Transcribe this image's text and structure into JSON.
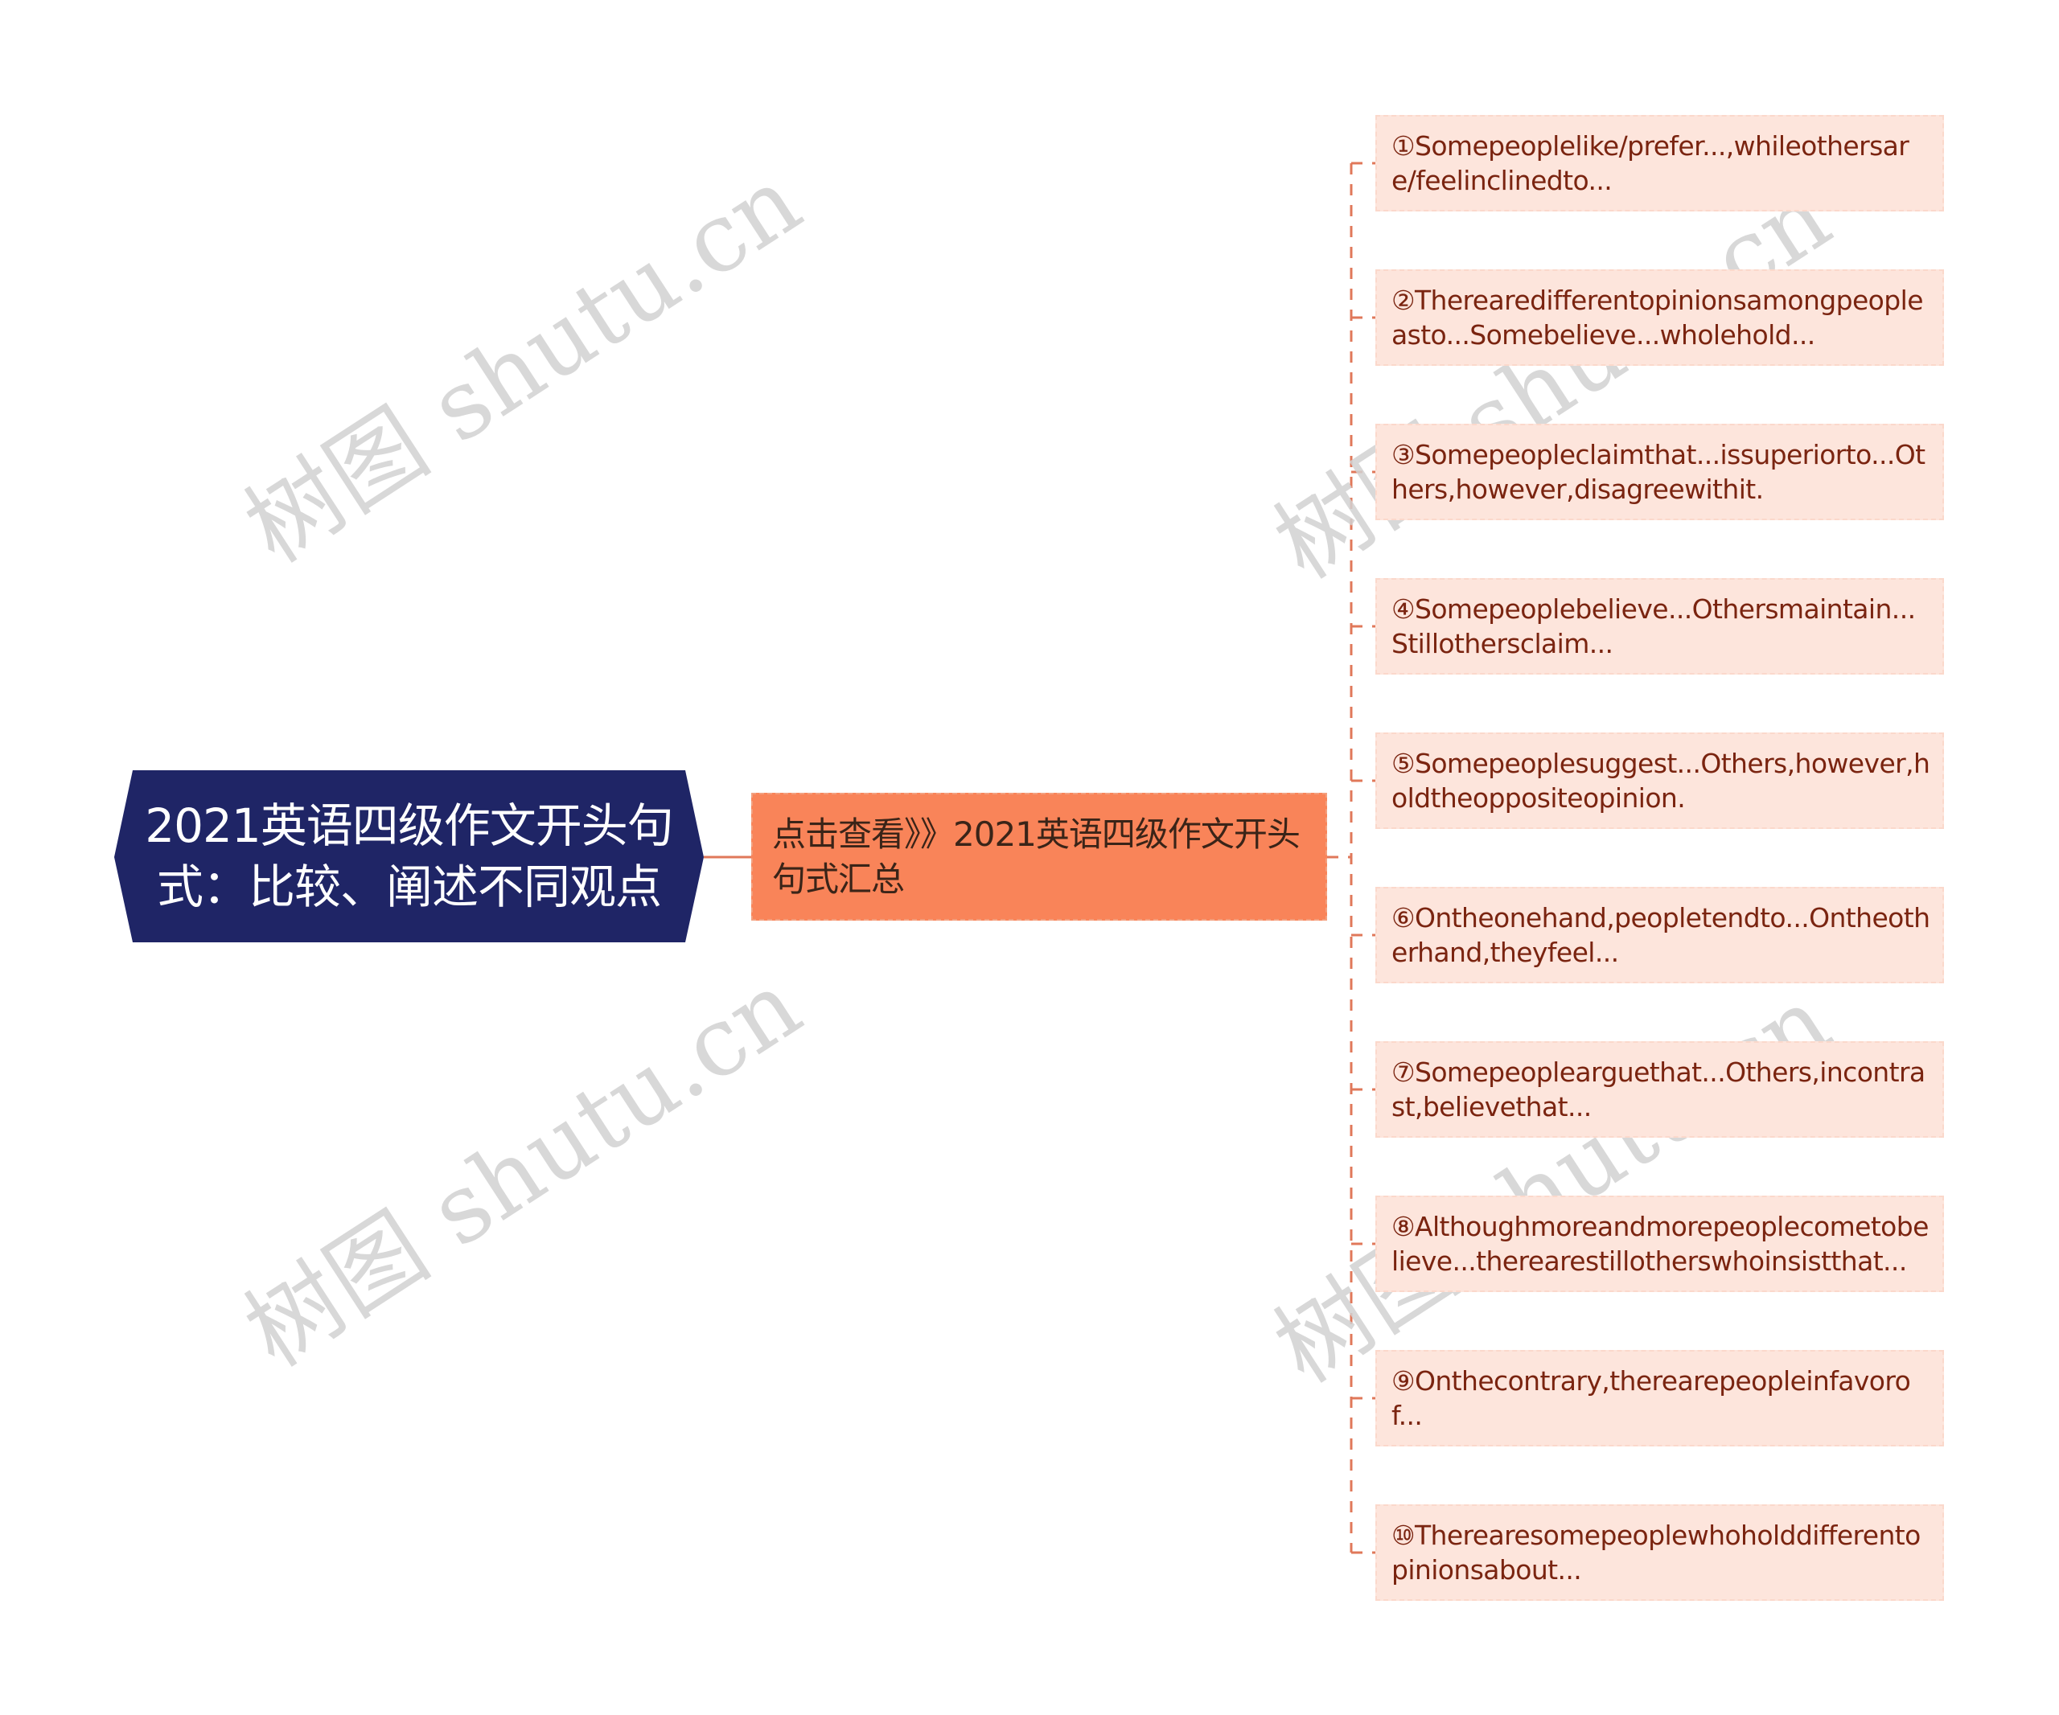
{
  "root": {
    "title": "2021英语四级作文开头句式：比较、阐述不同观点",
    "color": "#1f2566"
  },
  "middle": {
    "label": "点击查看》》2021英语四级作文开头句式汇总",
    "color": "#f98459"
  },
  "leaves": [
    {
      "text": "①Somepeoplelike/prefer...,whileothersare/feelinclinedto..."
    },
    {
      "text": "②Therearedifferentopinionsamongpeopleasto...Somebelieve...wholehold..."
    },
    {
      "text": "③Somepeopleclaimthat...issuperiorto...Others,however,disagreewithit."
    },
    {
      "text": "④Somepeoplebelieve...Othersmaintain...Stillothersclaim..."
    },
    {
      "text": "⑤Somepeoplesuggest...Others,however,holdtheoppositeopinion."
    },
    {
      "text": "⑥Ontheonehand,peopletendto...Ontheotherhand,theyfeel..."
    },
    {
      "text": "⑦Somepeoplearguethat...Others,incontrast,believethat..."
    },
    {
      "text": "⑧Althoughmoreandmorepeoplecometobelieve...therearestillotherswhoinsistthat..."
    },
    {
      "text": "⑨Onthecontrary,therearepeopleinfavorof..."
    },
    {
      "text": "⑩Therearesomepeoplewhoholddifferentopinionsabout..."
    }
  ],
  "colors": {
    "leaf_bg": "#fde5dc",
    "leaf_text": "#7a2410",
    "connector": "#e0785a"
  },
  "watermark": "树图 shutu.cn"
}
